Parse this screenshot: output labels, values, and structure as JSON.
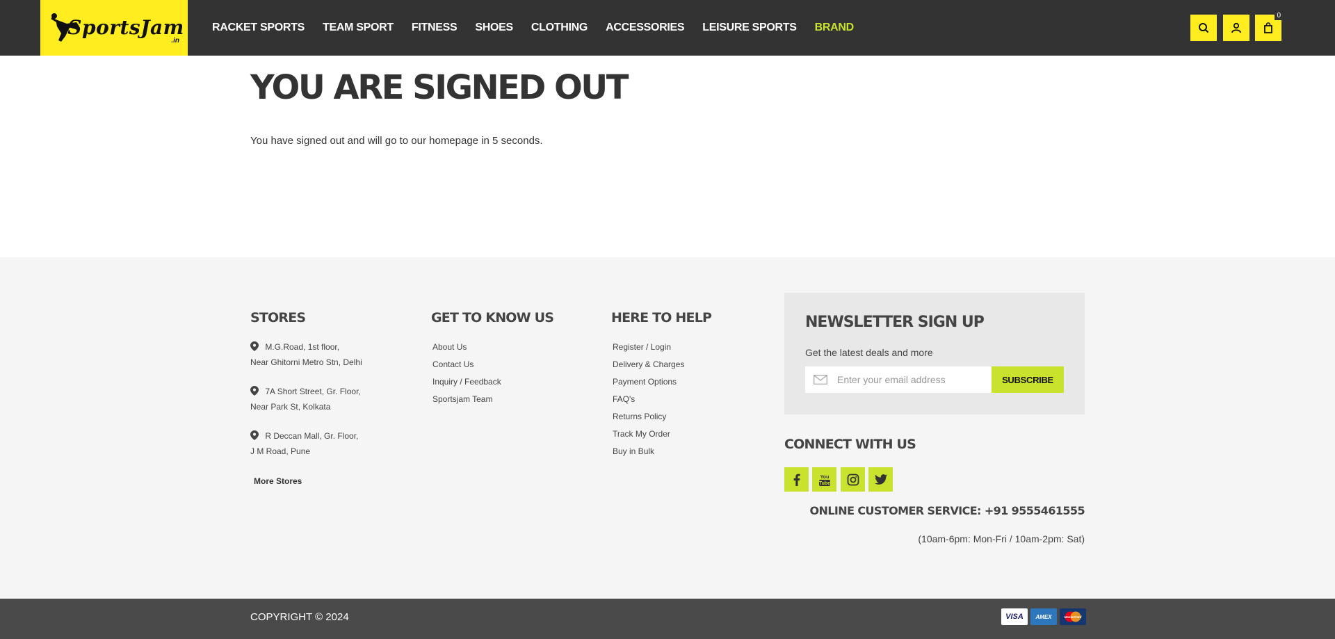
{
  "header": {
    "logo_text": "SportsJam",
    "logo_sub": ".in",
    "nav": [
      "RACKET SPORTS",
      "TEAM SPORT",
      "FITNESS",
      "SHOES",
      "CLOTHING",
      "ACCESSORIES",
      "LEISURE SPORTS",
      "BRAND"
    ],
    "cart_count": "0"
  },
  "main": {
    "title": "YOU ARE SIGNED OUT",
    "message": "You have signed out and will go to our homepage in 5 seconds."
  },
  "footer": {
    "stores_title": "STORES",
    "stores": [
      {
        "line1": "M.G.Road, 1st floor,",
        "line2": "Near Ghitorni Metro Stn, Delhi"
      },
      {
        "line1": "7A Short Street, Gr. Floor,",
        "line2": "Near Park St, Kolkata"
      },
      {
        "line1": "R Deccan Mall, Gr. Floor,",
        "line2": "J M Road, Pune"
      }
    ],
    "more_stores": "More Stores",
    "know_title": "GET TO KNOW US",
    "know_links": [
      "About Us",
      "Contact Us",
      "Inquiry / Feedback",
      "Sportsjam Team"
    ],
    "help_title": "HERE TO HELP",
    "help_links": [
      "Register / Login",
      "Delivery & Charges",
      "Payment Options",
      "FAQ's",
      "Returns Policy",
      "Track My Order",
      "Buy in Bulk"
    ],
    "newsletter": {
      "title": "NEWSLETTER SIGN UP",
      "subtitle": "Get the latest deals and more",
      "placeholder": "Enter your email address",
      "button": "SUBSCRIBE"
    },
    "connect_title": "CONNECT WITH US",
    "social_icons": [
      "facebook-icon",
      "youtube-icon",
      "instagram-icon",
      "twitter-icon"
    ],
    "customer_service": "ONLINE CUSTOMER SERVICE: +91 9555461555",
    "hours": "(10am-6pm: Mon-Fri / 10am-2pm: Sat)",
    "copyright": "COPYRIGHT © 2024",
    "payment_cards": [
      "VISA",
      "AMEX",
      "MasterCard"
    ]
  },
  "colors": {
    "header_bg": "#333333",
    "accent_yellow": "#ffed1f",
    "accent_green": "#c8e22d",
    "footer_bg": "#f5f5f5",
    "bottom_bar": "#4a4a4a"
  }
}
